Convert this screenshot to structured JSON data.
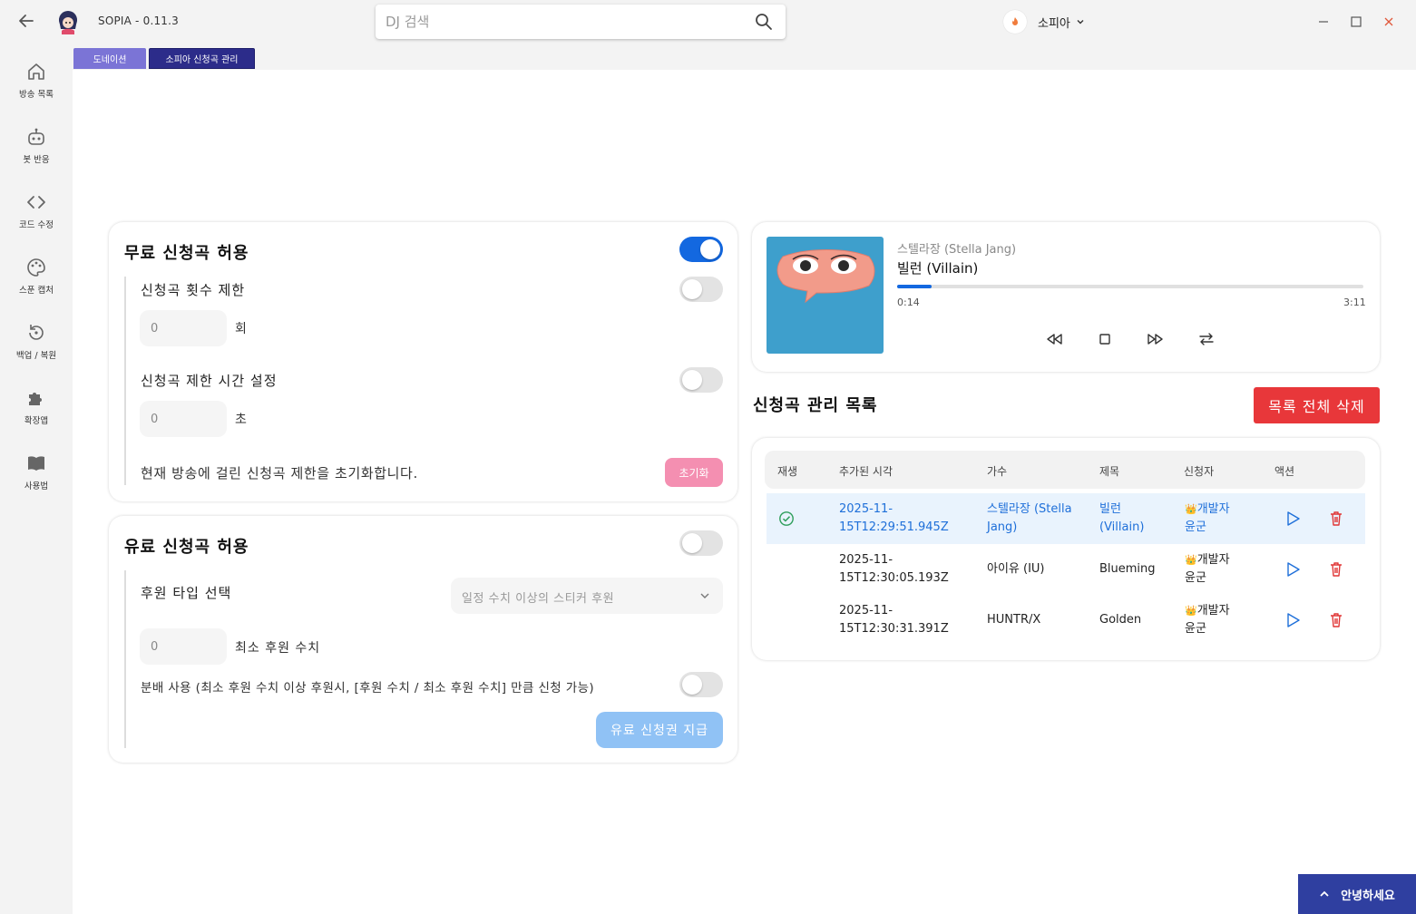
{
  "app": {
    "title": "SOPIA - 0.11.3",
    "search_placeholder": "DJ 검색",
    "user_name": "소피아"
  },
  "sidebar": {
    "items": [
      {
        "label": "방송 목록",
        "icon": "home-icon"
      },
      {
        "label": "봇 반응",
        "icon": "robot-icon"
      },
      {
        "label": "코드 수정",
        "icon": "code-icon"
      },
      {
        "label": "스푼 캡처",
        "icon": "palette-icon"
      },
      {
        "label": "백업 / 복원",
        "icon": "restore-icon"
      },
      {
        "label": "확장앱",
        "icon": "puzzle-icon"
      },
      {
        "label": "사용법",
        "icon": "book-icon"
      }
    ]
  },
  "tabs": [
    {
      "label": "도네이션"
    },
    {
      "label": "소피아 신청곡 관리"
    }
  ],
  "free_request": {
    "title": "무료 신청곡 허용",
    "enabled": true,
    "count_limit_label": "신청곡 횟수 제한",
    "count_limit_enabled": false,
    "count_value": "0",
    "count_unit": "회",
    "time_limit_label": "신청곡 제한 시간 설정",
    "time_limit_enabled": false,
    "time_value": "0",
    "time_unit": "초",
    "reset_text": "현재 방송에 걸린 신청곡 제한을 초기화합니다.",
    "reset_button": "초기화"
  },
  "paid_request": {
    "title": "유료 신청곡 허용",
    "enabled": false,
    "donation_type_label": "후원 타입 선택",
    "donation_type_value": "일정 수치 이상의 스티커 후원",
    "min_value": "0",
    "min_unit": "최소 후원 수치",
    "split_label": "분배 사용 (최소 후원 수치 이상 후원시, [후원 수치 / 최소 후원 수치] 만큼 신청 가능)",
    "split_enabled": false,
    "grant_button": "유료 신청권 지급"
  },
  "player": {
    "artist": "스텔라장 (Stella Jang)",
    "title": "빌런 (Villain)",
    "current_time": "0:14",
    "total_time": "3:11",
    "progress": 0.073
  },
  "request_list": {
    "title": "신청곡 관리 목록",
    "delete_all_button": "목록 전체 삭제",
    "columns": [
      "재생",
      "추가된 시각",
      "가수",
      "제목",
      "신청자",
      "액션"
    ],
    "rows": [
      {
        "time_line1": "2025-11-",
        "time_line2": "15T12:29:51.945Z",
        "artist_line1": "스텔라장 (Stella",
        "artist_line2": "Jang)",
        "title_line1": "빌런",
        "title_line2": "(Villain)",
        "requester_line1": "개발자",
        "requester_line2": "윤군",
        "playing": true
      },
      {
        "time_line1": "2025-11-",
        "time_line2": "15T12:30:05.193Z",
        "artist_line1": "아이유 (IU)",
        "artist_line2": "",
        "title_line1": "Blueming",
        "title_line2": "",
        "requester_line1": "개발자",
        "requester_line2": "윤군",
        "playing": false
      },
      {
        "time_line1": "2025-11-",
        "time_line2": "15T12:30:31.391Z",
        "artist_line1": "HUNTR/X",
        "artist_line2": "",
        "title_line1": "Golden",
        "title_line2": "",
        "requester_line1": "개발자",
        "requester_line2": "윤군",
        "playing": false
      }
    ]
  },
  "greeting_button": "안녕하세요",
  "colors": {
    "accent_blue": "#1368e0",
    "delete_red": "#e8373a",
    "reset_pink": "#f48fb1",
    "grant_blue": "#90c2f5",
    "tab_active": "#2c2c8a",
    "tab_inactive": "#7b74d6",
    "greet_bg": "#2f3fa0"
  }
}
